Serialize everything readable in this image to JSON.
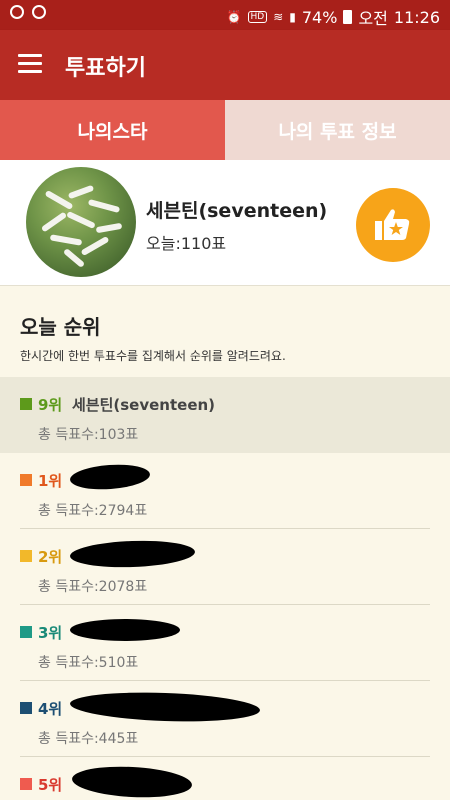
{
  "statusbar": {
    "battery": "74%",
    "ampm": "오전",
    "time": "11:26",
    "hd": "HD"
  },
  "appbar": {
    "title": "투표하기"
  },
  "tabs": [
    {
      "label": "나의스타",
      "active": true
    },
    {
      "label": "나의 투표 정보",
      "active": false
    }
  ],
  "mystar": {
    "name": "세븐틴(seventeen)",
    "today_votes": "오늘:110표"
  },
  "ranking": {
    "title": "오늘 순위",
    "description": "한시간에 한번 투표수를 집계해서 순위를 알려드려요.",
    "items": [
      {
        "rank": "9위",
        "name": "세븐틴(seventeen)",
        "total": "총 득표수:103표",
        "color": "#5d9a1b"
      },
      {
        "rank": "1위",
        "name": "",
        "total": "총 득표수:2794표",
        "color": "#f07a2a"
      },
      {
        "rank": "2위",
        "name": "",
        "total": "총 득표수:2078표",
        "color": "#f2b82a"
      },
      {
        "rank": "3위",
        "name": "",
        "total": "총 득표수:510표",
        "color": "#1f9a86"
      },
      {
        "rank": "4위",
        "name": "",
        "total": "총 득표수:445표",
        "color": "#1d4f73"
      },
      {
        "rank": "5위",
        "name": "",
        "total": "",
        "color": "#ef5b4f"
      }
    ]
  },
  "colors": {
    "statusbar": "#a8201a",
    "appbar": "#b72c24",
    "tab_active": "#e2584d",
    "tab_inactive": "#efd9d2",
    "vote_button": "#f7a419",
    "background": "#fbf7e8"
  }
}
